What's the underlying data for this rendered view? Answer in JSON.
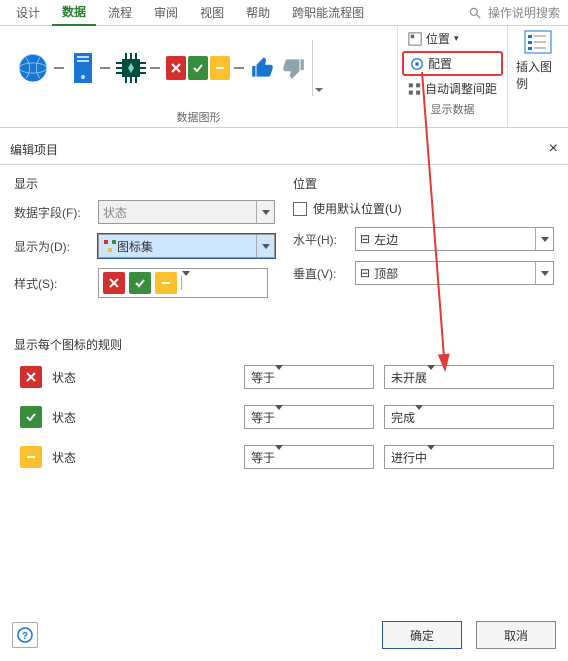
{
  "tabs": {
    "design": "设计",
    "data": "数据",
    "process": "流程",
    "review": "审阅",
    "view": "视图",
    "help": "帮助",
    "crossfunc": "跨职能流程图",
    "search_placeholder": "操作说明搜索"
  },
  "ribbon": {
    "group1_label": "数据图形",
    "position_btn": "位置",
    "config_btn": "配置",
    "auto_adjust": "自动调整间距",
    "insert_legend": "插入图例",
    "show_data": "显示数据"
  },
  "dialog": {
    "title": "编辑项目",
    "close": "×",
    "display_head": "显示",
    "position_head": "位置",
    "data_field_label": "数据字段(F):",
    "data_field_value": "状态",
    "show_as_label": "显示为(D):",
    "show_as_value": "图标集",
    "style_label": "样式(S):",
    "use_default_pos": "使用默认位置(U)",
    "horiz_label": "水平(H):",
    "horiz_value": "左边",
    "vert_label": "垂直(V):",
    "vert_value": "顶部",
    "h_icon": "⊟",
    "v_icon": "⊟",
    "rules_head": "显示每个图标的规则",
    "rules": [
      {
        "color": "red",
        "label": "状态",
        "op": "等于",
        "val": "未开展"
      },
      {
        "color": "green",
        "label": "状态",
        "op": "等于",
        "val": "完成"
      },
      {
        "color": "yellow",
        "label": "状态",
        "op": "等于",
        "val": "进行中"
      }
    ],
    "ok": "确定",
    "cancel": "取消",
    "help": "?"
  }
}
